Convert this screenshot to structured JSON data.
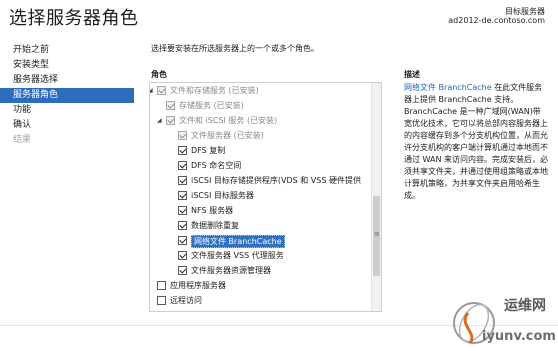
{
  "header": {
    "title": "选择服务器角色",
    "target_label": "目标服务器",
    "target_server": "ad2012-de.contoso.com"
  },
  "sidebar": {
    "items": [
      {
        "label": "开始之前",
        "state": "normal"
      },
      {
        "label": "安装类型",
        "state": "normal"
      },
      {
        "label": "服务器选择",
        "state": "normal"
      },
      {
        "label": "服务器角色",
        "state": "active"
      },
      {
        "label": "功能",
        "state": "normal"
      },
      {
        "label": "确认",
        "state": "normal"
      },
      {
        "label": "结果",
        "state": "disabled"
      }
    ]
  },
  "main": {
    "instruction": "选择要安装在所选服务器上的一个或多个角色。",
    "roles_header": "角色",
    "description_header": "描述",
    "roles": [
      {
        "label": "文件和存储服务 (已安装)",
        "level": 0,
        "expander": "expanded",
        "checked": true,
        "greyed": true
      },
      {
        "label": "存储服务 (已安装)",
        "level": 1,
        "expander": "none",
        "checked": true,
        "greyed": true
      },
      {
        "label": "文件和 iSCSI 服务 (已安装)",
        "level": 1,
        "expander": "expanded",
        "checked": true,
        "greyed": true
      },
      {
        "label": "文件服务器 (已安装)",
        "level": 2,
        "expander": "none",
        "checked": true,
        "greyed": true
      },
      {
        "label": "DFS 复制",
        "level": 2,
        "expander": "none",
        "checked": true,
        "greyed": false
      },
      {
        "label": "DFS 命名空间",
        "level": 2,
        "expander": "none",
        "checked": true,
        "greyed": false
      },
      {
        "label": "iSCSI 目标存储提供程序(VDS 和 VSS 硬件提供",
        "level": 2,
        "expander": "none",
        "checked": true,
        "greyed": false
      },
      {
        "label": "iSCSI 目标服务器",
        "level": 2,
        "expander": "none",
        "checked": true,
        "greyed": false
      },
      {
        "label": "NFS 服务器",
        "level": 2,
        "expander": "none",
        "checked": true,
        "greyed": false
      },
      {
        "label": "数据删除重复",
        "level": 2,
        "expander": "none",
        "checked": true,
        "greyed": false
      },
      {
        "label": "网络文件 BranchCache",
        "level": 2,
        "expander": "none",
        "checked": true,
        "greyed": false,
        "selected": true
      },
      {
        "label": "文件服务器 VSS 代理服务",
        "level": 2,
        "expander": "none",
        "checked": true,
        "greyed": false
      },
      {
        "label": "文件服务器资源管理器",
        "level": 2,
        "expander": "none",
        "checked": true,
        "greyed": false
      },
      {
        "label": "应用程序服务器",
        "level": 0,
        "expander": "none",
        "checked": false,
        "greyed": false
      },
      {
        "label": "远程访问",
        "level": 0,
        "expander": "none",
        "checked": false,
        "greyed": false
      }
    ],
    "description": {
      "link_text": "网络文件 BranchCache",
      "body": "在此文件服务器上提供 BranchCache 支持。BranchCache 是一种广域网(WAN)带宽优化技术，它可以将总部内容服务器上的内容缓存到多个分支机构位置，从而允许分支机构的客户端计算机通过本地而不通过 WAN 来访问内容。完成安装后，必须共享文件夹，并通过使用组策略或本地计算机策略，为共享文件夹启用哈希生成。"
    }
  },
  "watermark": {
    "cn": "运维网",
    "en": "iyunv.com"
  },
  "colors": {
    "accent": "#2c6ebd",
    "link": "#2068b9",
    "selection": "#2f71c2"
  }
}
